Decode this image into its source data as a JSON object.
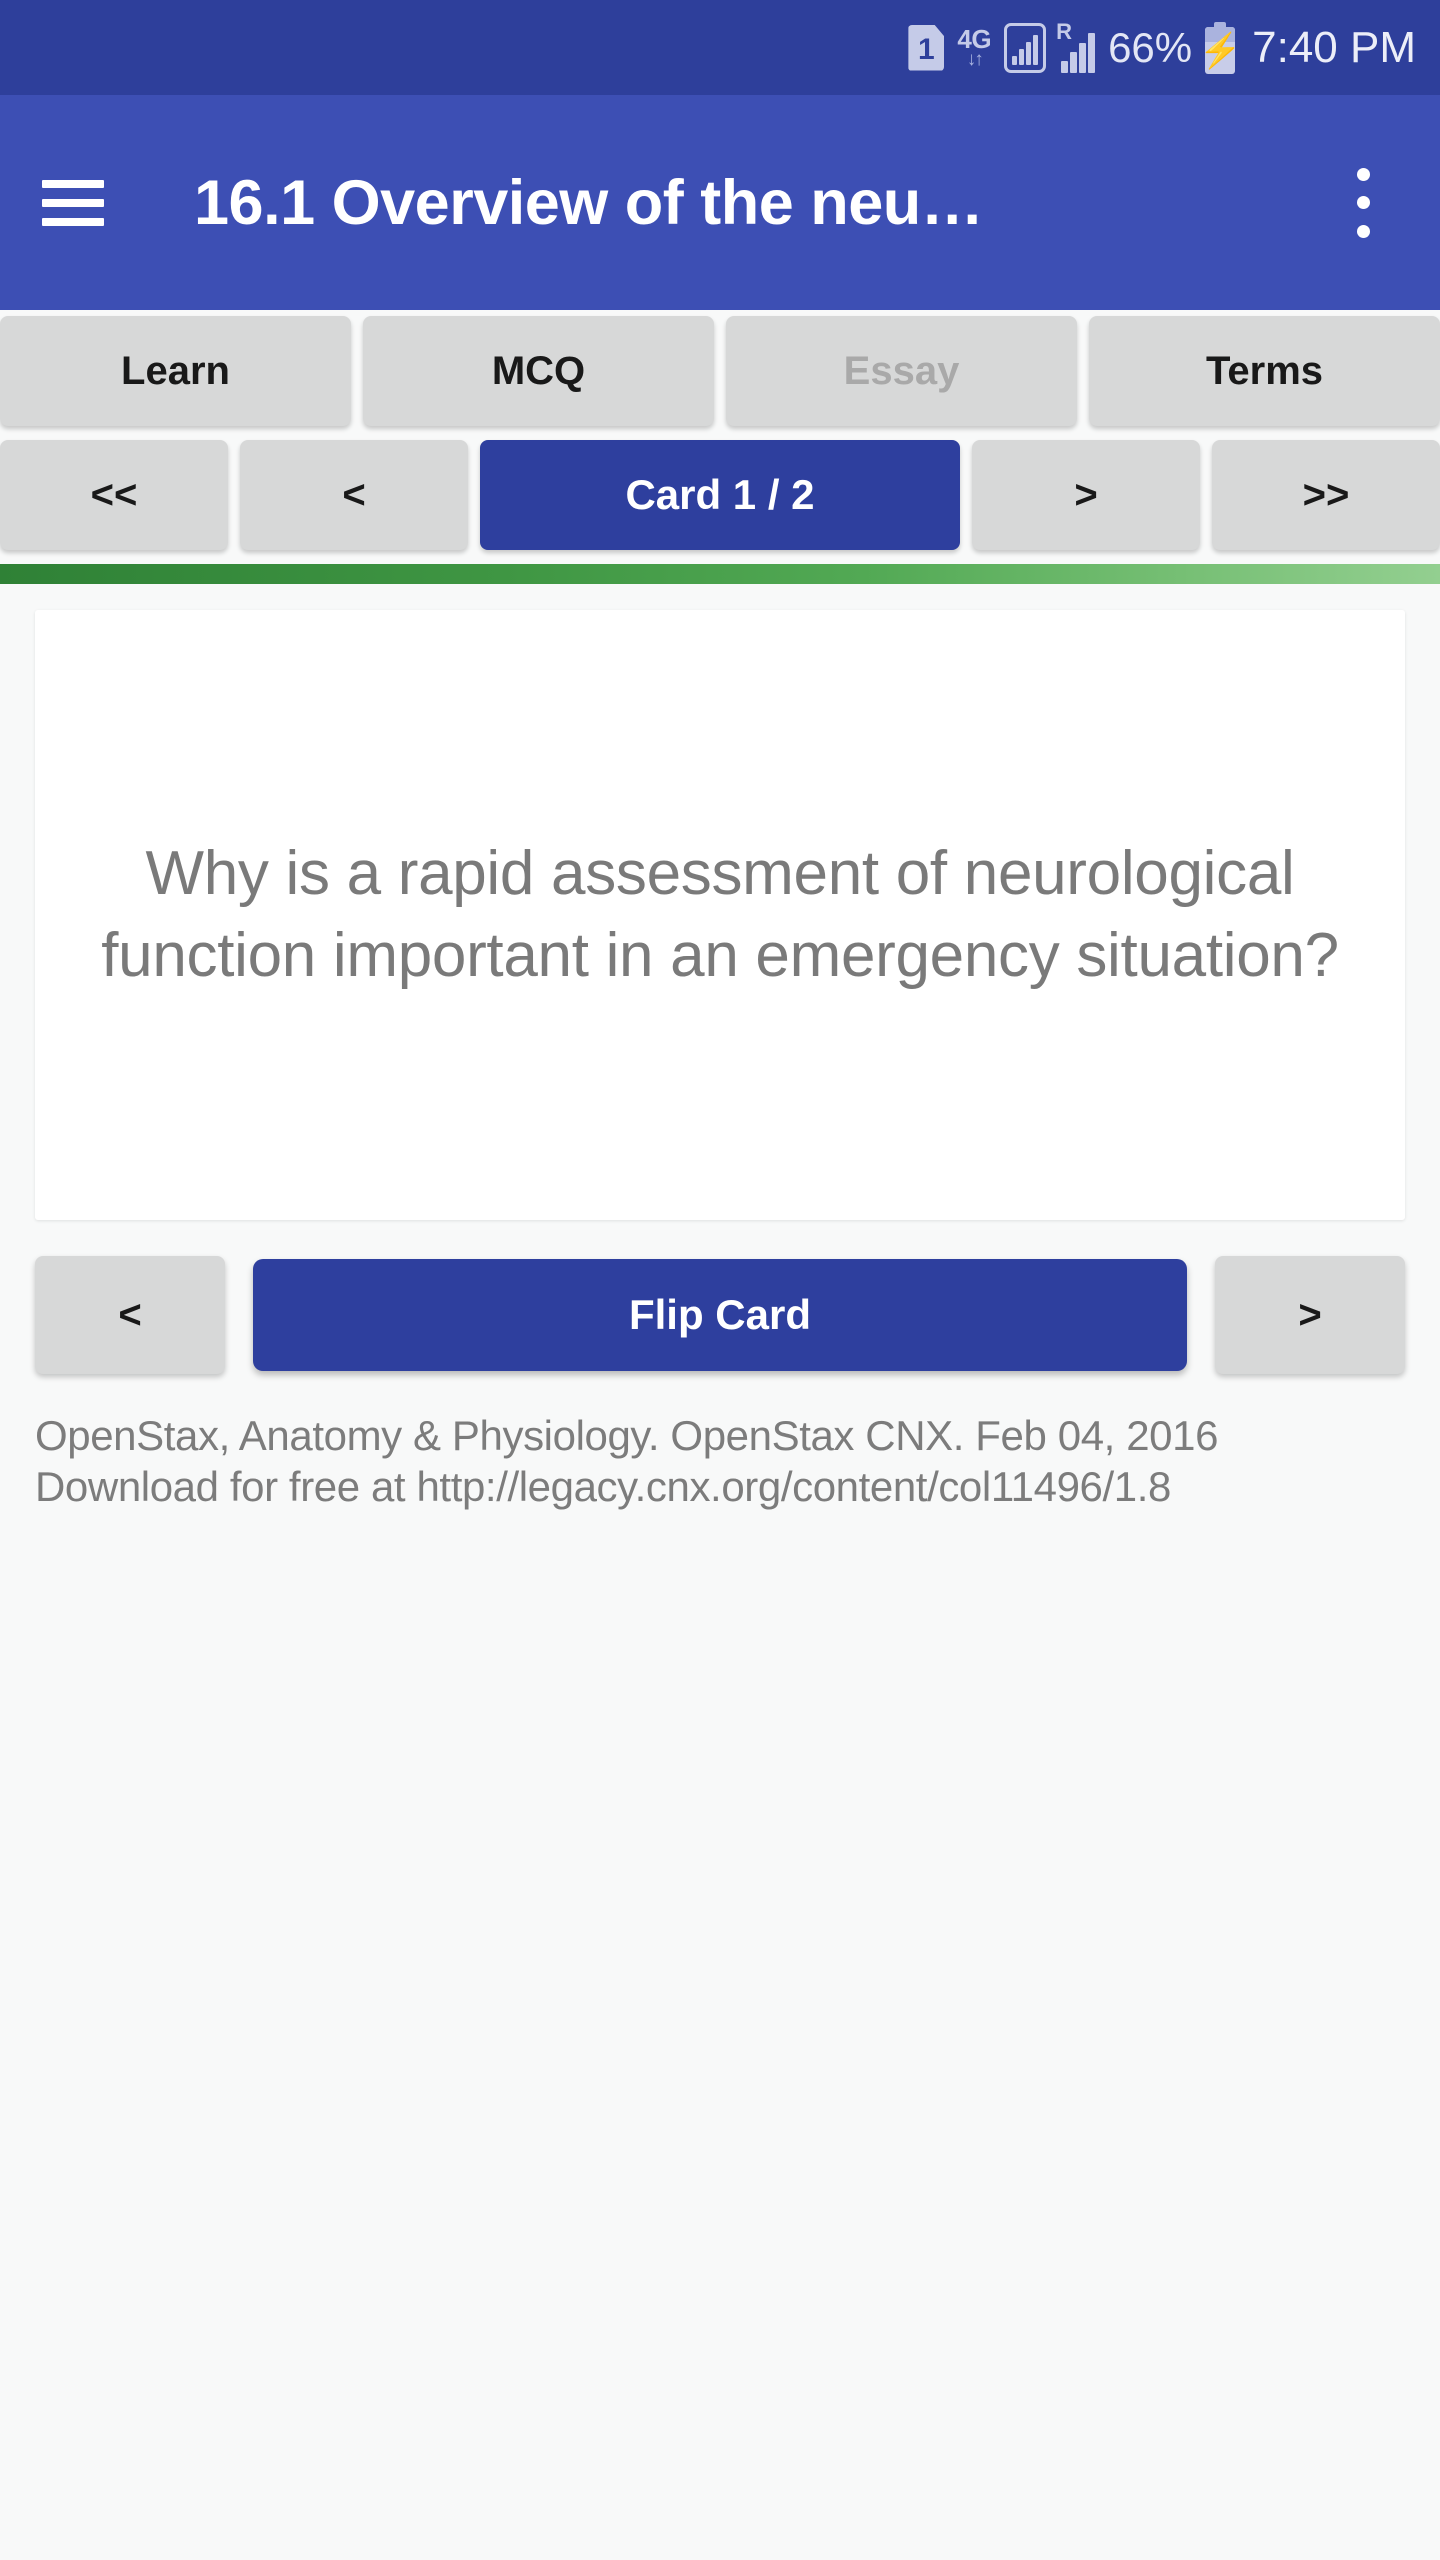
{
  "status_bar": {
    "sim_badge": "1",
    "network_type": "4G",
    "data_arrows": "↓↑",
    "roaming_label": "R",
    "battery_percent": "66%",
    "time": "7:40 PM",
    "background_color": "#2e3f9b",
    "icons": {
      "sim": "sim-card-icon",
      "network": "network-4g-icon",
      "wifi": "signal-box-icon",
      "roaming": "roaming-signal-icon",
      "battery": "battery-charging-icon"
    }
  },
  "app_bar": {
    "title": "16.1 Overview of the neu…",
    "menu_icon": "hamburger-menu-icon",
    "overflow_icon": "overflow-menu-icon",
    "background_color": "#3d4fb4"
  },
  "tabs": [
    {
      "label": "Learn",
      "disabled": false
    },
    {
      "label": "MCQ",
      "disabled": false
    },
    {
      "label": "Essay",
      "disabled": true
    },
    {
      "label": "Terms",
      "disabled": false
    }
  ],
  "card_nav": {
    "first_label": "<<",
    "prev_label": "<",
    "indicator_label": "Card 1 / 2",
    "next_label": ">",
    "last_label": ">>",
    "active_color": "#2e3f9e"
  },
  "progress": {
    "value_percent": 100,
    "gradient_start": "#2f8136",
    "gradient_end": "#93cf90"
  },
  "flash_card": {
    "question": "Why is a rapid assessment of neurological function important in an emergency situation?",
    "text_color": "#7a7a7a",
    "background_color": "#ffffff"
  },
  "flip_controls": {
    "prev_label": "<",
    "flip_label": "Flip Card",
    "next_label": ">"
  },
  "attribution": {
    "line1": "OpenStax, Anatomy & Physiology. OpenStax CNX. Feb 04, 2016",
    "line2": "Download for free at http://legacy.cnx.org/content/col11496/1.8"
  }
}
